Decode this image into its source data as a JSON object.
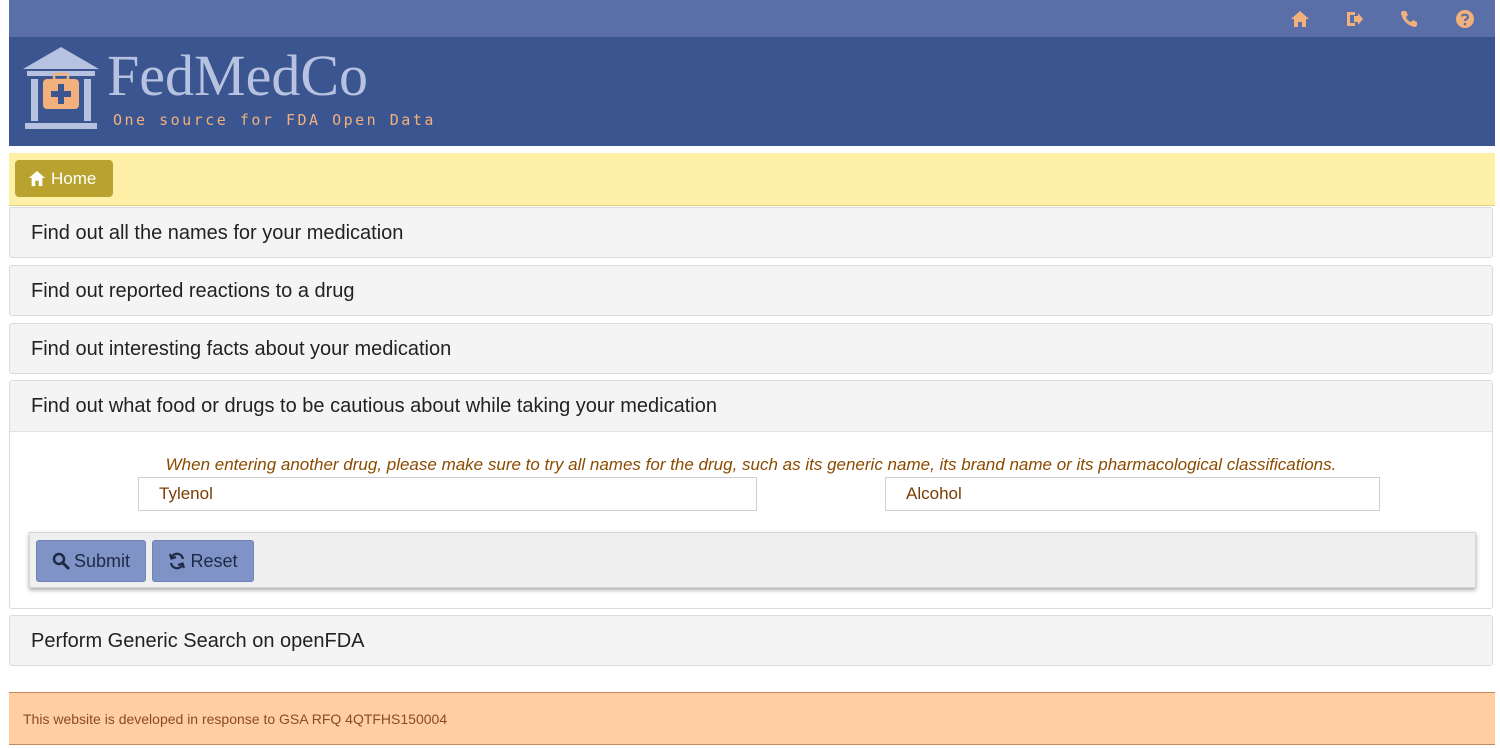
{
  "topbar": {
    "icons": [
      "home-icon",
      "logout-icon",
      "phone-icon",
      "help-icon"
    ]
  },
  "header": {
    "brand": "FedMedCo",
    "tagline": "One source for FDA Open Data"
  },
  "breadcrumb": {
    "home_label": "Home"
  },
  "accordion": {
    "names": "Find out all the names for your medication",
    "reactions": "Find out reported reactions to a drug",
    "facts": "Find out interesting facts about your medication",
    "interactions": "Find out what food or drugs to be cautious about while taking your medication",
    "generic": "Perform Generic Search on openFDA"
  },
  "interactions_form": {
    "hint": "When entering another drug, please make sure to try all names for the drug, such as its generic name, its brand name or its pharmacological classifications.",
    "drug1_value": "Tylenol",
    "drug2_value": "Alcohol",
    "submit_label": "Submit",
    "reset_label": "Reset"
  },
  "footer": {
    "text": "This website is developed in response to GSA RFQ 4QTFHS150004"
  },
  "colors": {
    "topbar": "#5a6fa8",
    "header": "#3b5591",
    "accent_orange": "#f2b07d",
    "breadcrumb_bg": "#fff0a8",
    "home_button": "#b9a22d",
    "action_button": "#7f93c6",
    "footer_bg": "#ffcfa3"
  }
}
